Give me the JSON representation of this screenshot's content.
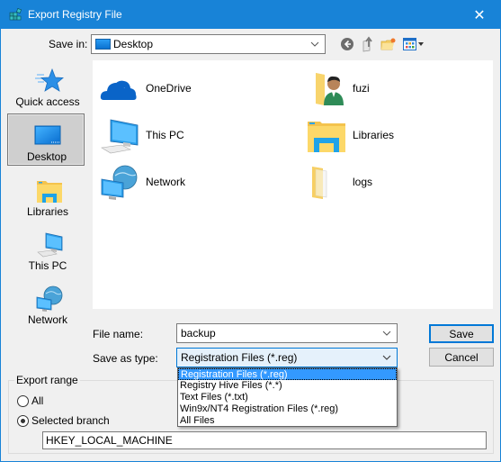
{
  "window": {
    "title": "Export Registry File",
    "close_glyph": "✕"
  },
  "toolbar": {
    "save_in_label": "Save in:",
    "save_in_value": "Desktop",
    "icons": [
      "back-icon",
      "up-folder-icon",
      "new-folder-icon",
      "view-menu-icon"
    ]
  },
  "places": [
    {
      "label": "Quick access",
      "icon": "star-icon",
      "selected": false
    },
    {
      "label": "Desktop",
      "icon": "desktop-icon",
      "selected": true
    },
    {
      "label": "Libraries",
      "icon": "libraries-icon",
      "selected": false
    },
    {
      "label": "This PC",
      "icon": "computer-icon",
      "selected": false
    },
    {
      "label": "Network",
      "icon": "network-icon",
      "selected": false
    }
  ],
  "files": [
    {
      "label": "OneDrive",
      "icon": "onedrive-icon"
    },
    {
      "label": "fuzi",
      "icon": "user-folder-icon"
    },
    {
      "label": "This PC",
      "icon": "computer-icon"
    },
    {
      "label": "Libraries",
      "icon": "libraries-icon"
    },
    {
      "label": "Network",
      "icon": "network-icon"
    },
    {
      "label": "logs",
      "icon": "folder-icon"
    }
  ],
  "form": {
    "file_name_label": "File name:",
    "file_name_value": "backup",
    "save_as_type_label": "Save as type:",
    "save_as_type_value": "Registration Files (*.reg)",
    "save_as_type_options": [
      "Registration Files (*.reg)",
      "Registry Hive Files (*.*)",
      "Text Files (*.txt)",
      "Win9x/NT4 Registration Files (*.reg)",
      "All Files"
    ],
    "selected_option_index": 0
  },
  "buttons": {
    "save": "Save",
    "cancel": "Cancel"
  },
  "export_range": {
    "legend": "Export range",
    "all_label": "All",
    "selected_branch_label": "Selected branch",
    "selected": "Selected branch",
    "branch_value": "HKEY_LOCAL_MACHINE"
  },
  "colors": {
    "titlebar": "#1883d7",
    "accent": "#0078d7",
    "selection": "#3399ff"
  }
}
